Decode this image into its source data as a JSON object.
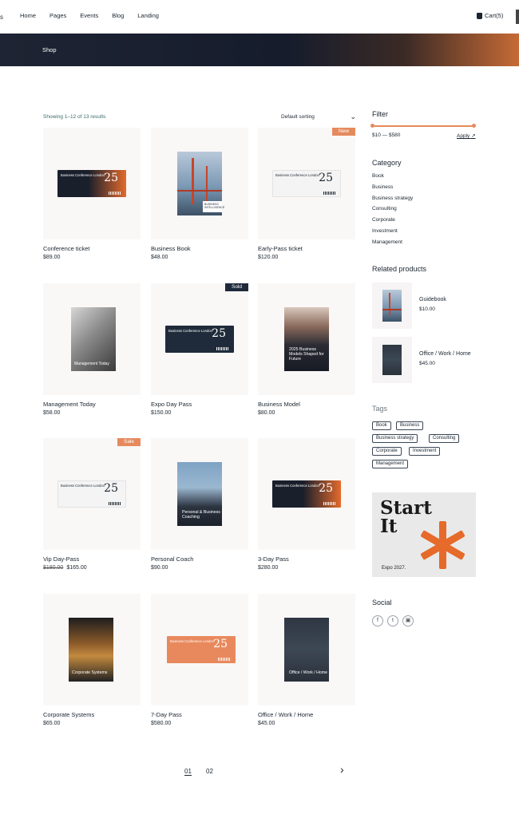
{
  "nav": {
    "items": [
      "Home",
      "Pages",
      "Events",
      "Blog",
      "Landing"
    ],
    "cart_label": "Cart(5)"
  },
  "banner": {
    "breadcrumb": "Shop"
  },
  "toolbar": {
    "results": "Showing 1–12 of 13 results",
    "sort": "Default sorting"
  },
  "products": [
    {
      "name": "Conference ticket",
      "price": "$89.00"
    },
    {
      "name": "Business Book",
      "price": "$48.00"
    },
    {
      "name": "Early-Pass ticket",
      "price": "$120.00",
      "badge": "New"
    },
    {
      "name": "Management Today",
      "price": "$58.00"
    },
    {
      "name": "Expo Day Pass",
      "price": "$150.00",
      "badge": "Sold"
    },
    {
      "name": "Business Model",
      "price": "$80.00"
    },
    {
      "name": "Vip Day-Pass",
      "old_price": "$180.00",
      "price": "$165.00",
      "badge": "Sale"
    },
    {
      "name": "Personal Coach",
      "price": "$90.00"
    },
    {
      "name": "3-Day Pass",
      "price": "$280.00"
    },
    {
      "name": "Corporate Systems",
      "price": "$65.00"
    },
    {
      "name": "7-Day Pass",
      "price": "$580.00"
    },
    {
      "name": "Office / Work / Home",
      "price": "$45.00"
    }
  ],
  "art": {
    "ticket_title": "Business Conference London",
    "ticket_year": "25",
    "bridge_label": "BUSINESS INTELLIGENCE",
    "management": "Management Today",
    "models": "2025 Business Models Shaped for Future",
    "coach": "Personal & Business Coaching",
    "corporate": "Corporate Systems",
    "office": "Office / Work / Home"
  },
  "sidebar": {
    "filter_title": "Filter",
    "range": "$10 — $580",
    "apply": "Apply",
    "category_title": "Category",
    "categories": [
      "Book",
      "Business",
      "Business strategy",
      "Consulting",
      "Corporate",
      "Investment",
      "Management"
    ],
    "related_title": "Related products",
    "related": [
      {
        "name": "Guidebook",
        "price": "$10.00"
      },
      {
        "name": "Office / Work / Home",
        "price": "$45.00"
      }
    ],
    "tags_title": "Tags",
    "tags": [
      "Book",
      "Business",
      "Business strategy",
      "Consulting",
      "Corporate",
      "Investment",
      "Management"
    ],
    "promo": {
      "line1": "Start",
      "line2": "It",
      "foot": "Expo 2027."
    },
    "social_title": "Social",
    "social_icons": [
      "facebook-icon",
      "twitter-icon",
      "instagram-icon"
    ]
  },
  "pagination": {
    "pages": [
      "01",
      "02"
    ],
    "active": "01"
  },
  "colors": {
    "accent": "#e58a5d",
    "navy": "#1e2a3a",
    "banner_dark": "#151c2c"
  }
}
